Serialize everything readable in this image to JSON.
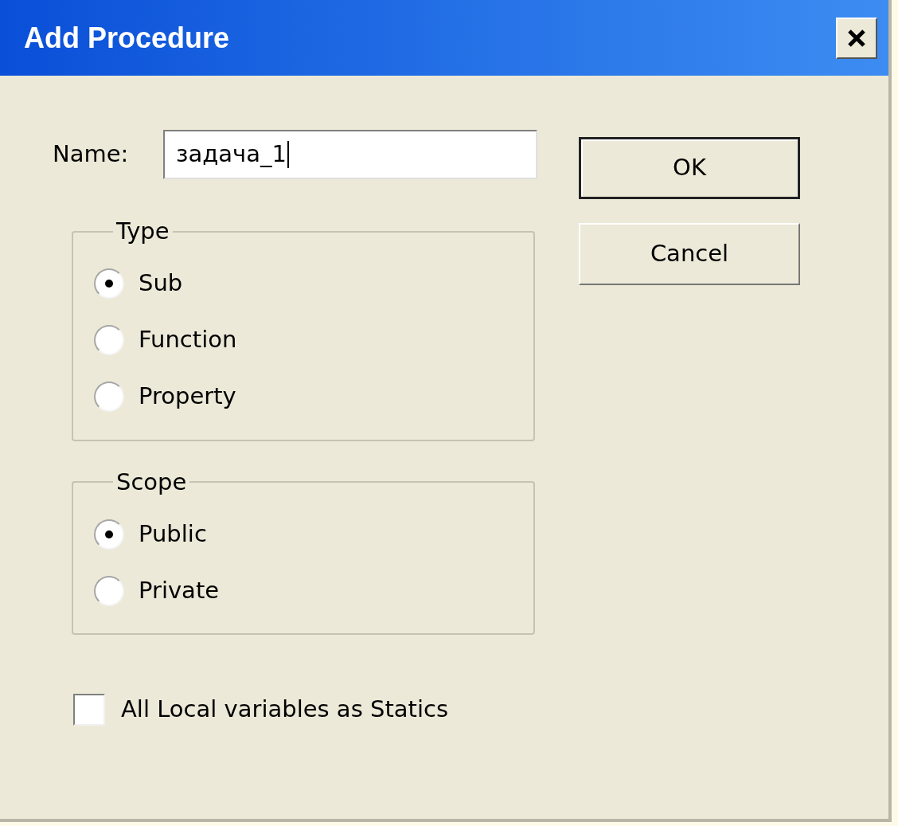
{
  "window": {
    "title": "Add Procedure"
  },
  "name_field": {
    "label": "Name:",
    "value": "задача_1"
  },
  "buttons": [
    {
      "label": "OK",
      "default": true
    },
    {
      "label": "Cancel",
      "default": false
    }
  ],
  "groups": [
    {
      "title": "Type",
      "options": [
        {
          "label": "Sub",
          "selected": true
        },
        {
          "label": "Function",
          "selected": false
        },
        {
          "label": "Property",
          "selected": false
        }
      ]
    },
    {
      "title": "Scope",
      "options": [
        {
          "label": "Public",
          "selected": true
        },
        {
          "label": "Private",
          "selected": false
        }
      ]
    }
  ],
  "checkbox": {
    "label": "All Local variables as Statics",
    "checked": false
  }
}
